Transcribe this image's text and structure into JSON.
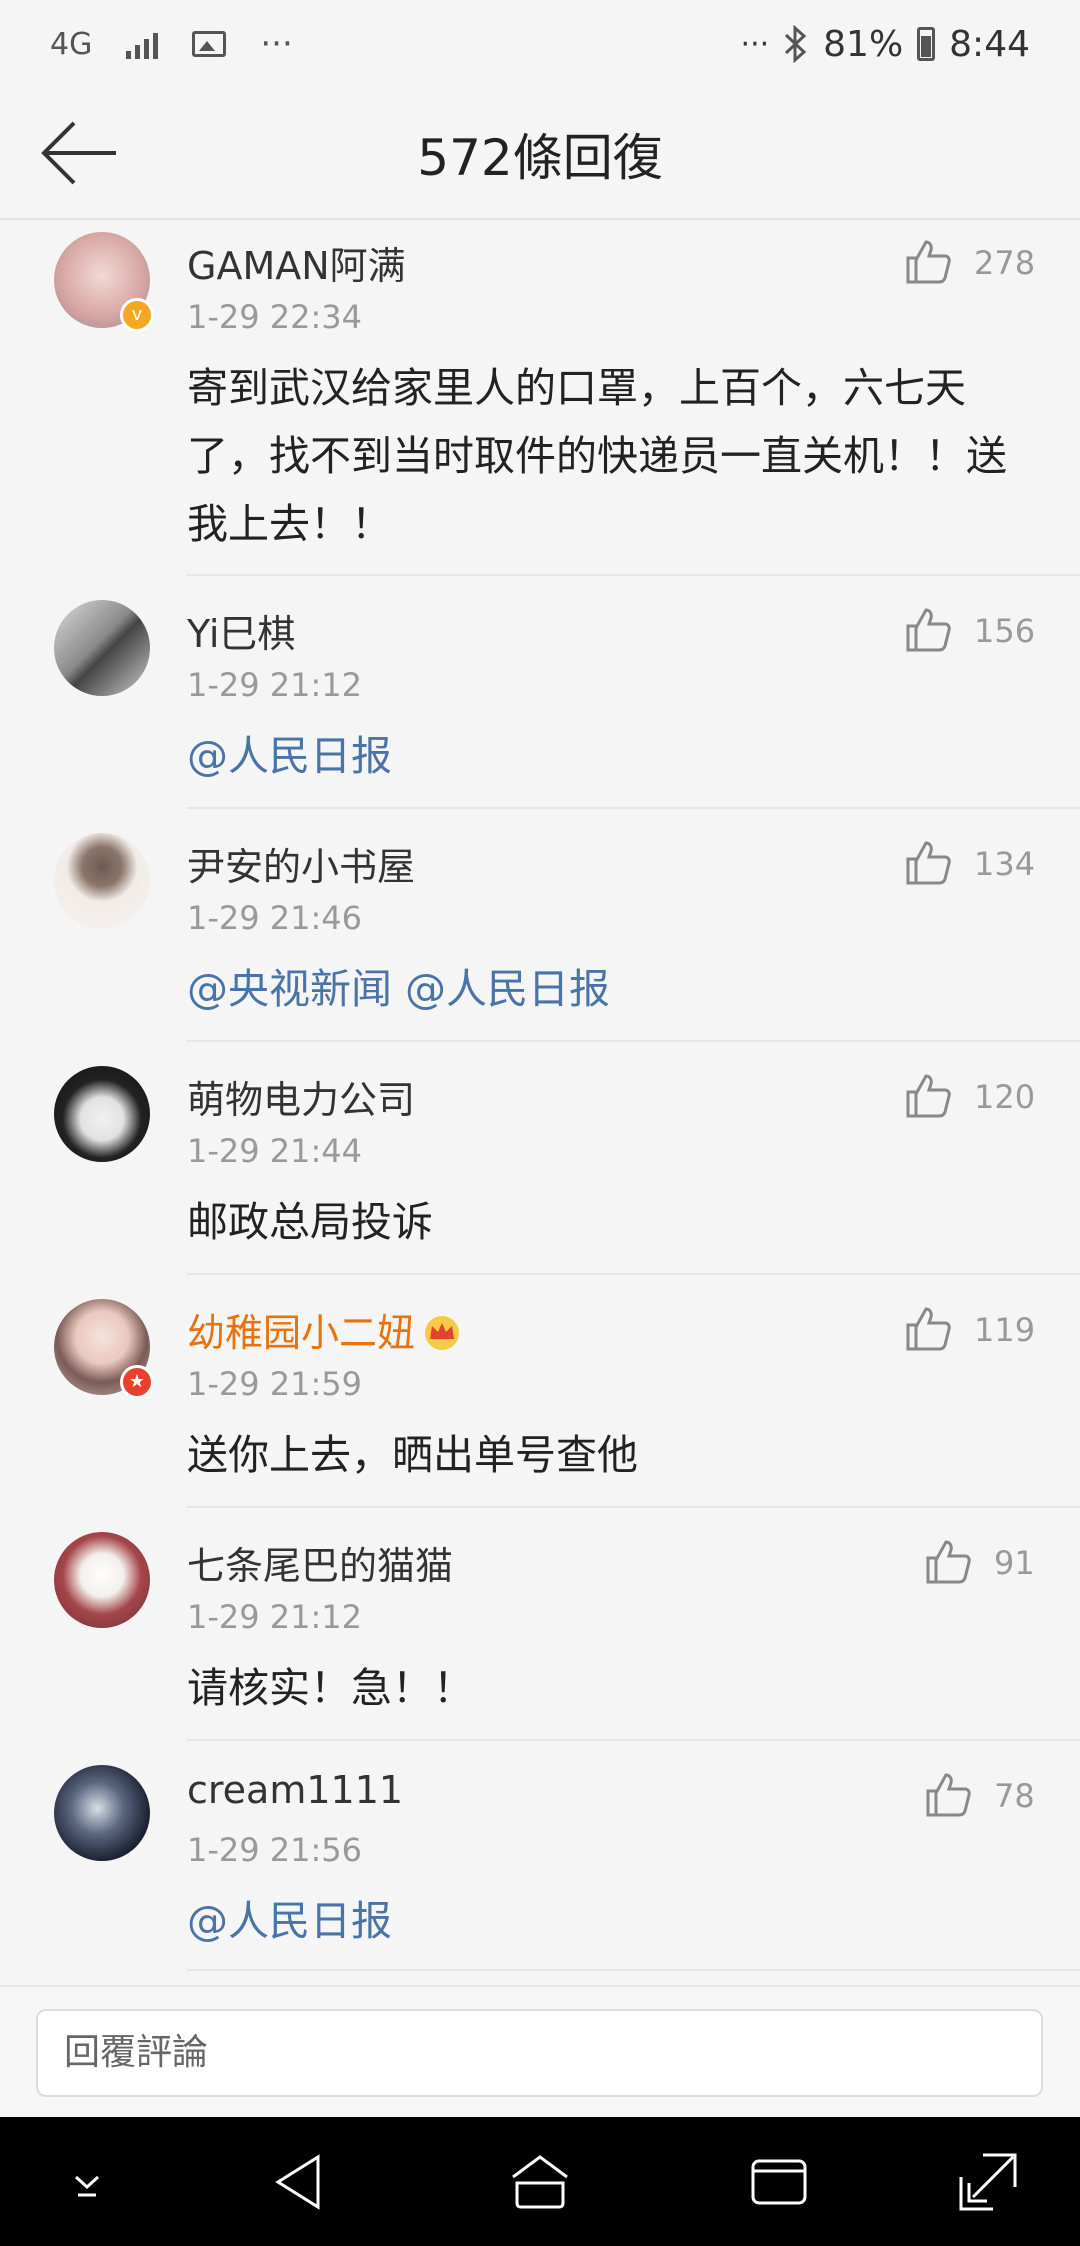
{
  "status_bar": {
    "network": "4G",
    "dots_left": "···",
    "dots_right": "···",
    "battery": "81%",
    "time": "8:44"
  },
  "header": {
    "title": "572條回復"
  },
  "comments": [
    {
      "name": "GAMAN阿满",
      "time": "1-29 22:34",
      "likes": "278",
      "text": "寄到武汉给家里人的口罩，上百个，六七天了，找不到当时取件的快递员一直关机！！送我上去！！",
      "mention": ""
    },
    {
      "name": "Yi巳棋",
      "time": "1-29 21:12",
      "likes": "156",
      "text": "",
      "mention": "@人民日报"
    },
    {
      "name": "尹安的小书屋",
      "time": "1-29 21:46",
      "likes": "134",
      "text": "",
      "mention": "@央视新闻 @人民日报"
    },
    {
      "name": "萌物电力公司",
      "time": "1-29 21:44",
      "likes": "120",
      "text": "邮政总局投诉",
      "mention": ""
    },
    {
      "name": "幼稚园小二妞",
      "time": "1-29 21:59",
      "likes": "119",
      "text": "送你上去，晒出单号查他",
      "mention": ""
    },
    {
      "name": "七条尾巴的猫猫",
      "time": "1-29 21:12",
      "likes": "91",
      "text": "请核实！急！！",
      "mention": ""
    },
    {
      "name": "cream1111",
      "time": "1-29 21:56",
      "likes": "78",
      "text": "",
      "mention": "@人民日报"
    }
  ],
  "reply": {
    "placeholder": "回覆評論"
  },
  "colors": {
    "mention": "#4a74a8",
    "vip_name": "#e8720c",
    "verified_badge": "#f5a623",
    "vip_badge": "#e5412d"
  }
}
